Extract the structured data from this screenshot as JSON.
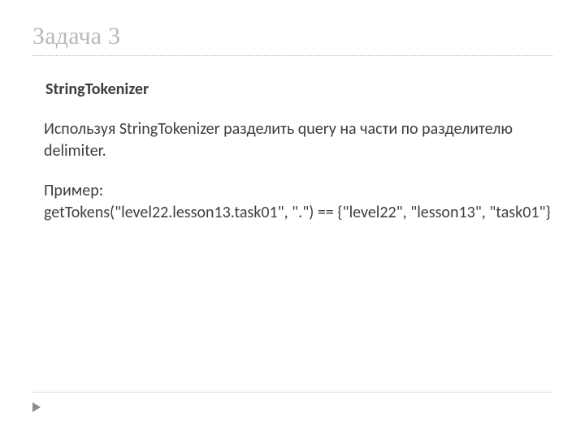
{
  "title": "Задача 3",
  "content": {
    "subheading": "StringTokenizer",
    "description": "Используя StringTokenizer разделить query на части по разделителю delimiter.",
    "example_label": "Пример:",
    "example_code": "getTokens(\"level22.lesson13.task01\", \".\") == {\"level22\", \"lesson13\", \"task01\"}"
  }
}
